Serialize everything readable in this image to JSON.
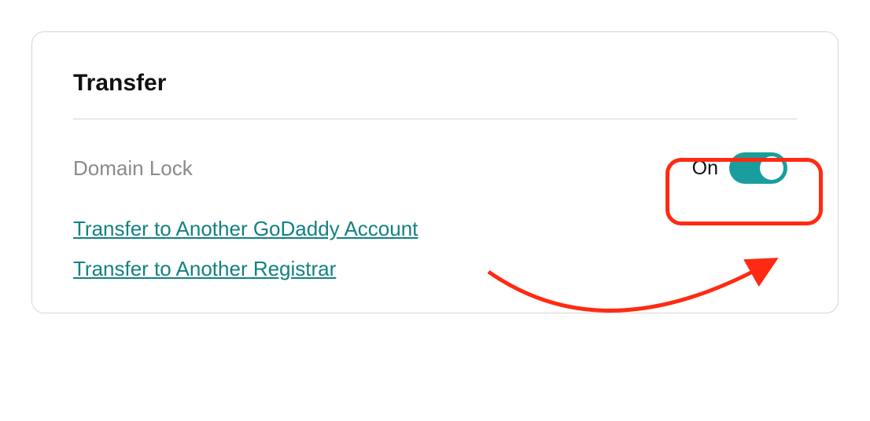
{
  "card": {
    "title": "Transfer",
    "domain_lock": {
      "label": "Domain Lock",
      "state_label": "On"
    },
    "links": {
      "transfer_account": "Transfer to Another GoDaddy Account",
      "transfer_registrar": "Transfer to Another Registrar"
    }
  },
  "colors": {
    "accent": "#1a9d9d",
    "annotation": "#ff2a12"
  }
}
